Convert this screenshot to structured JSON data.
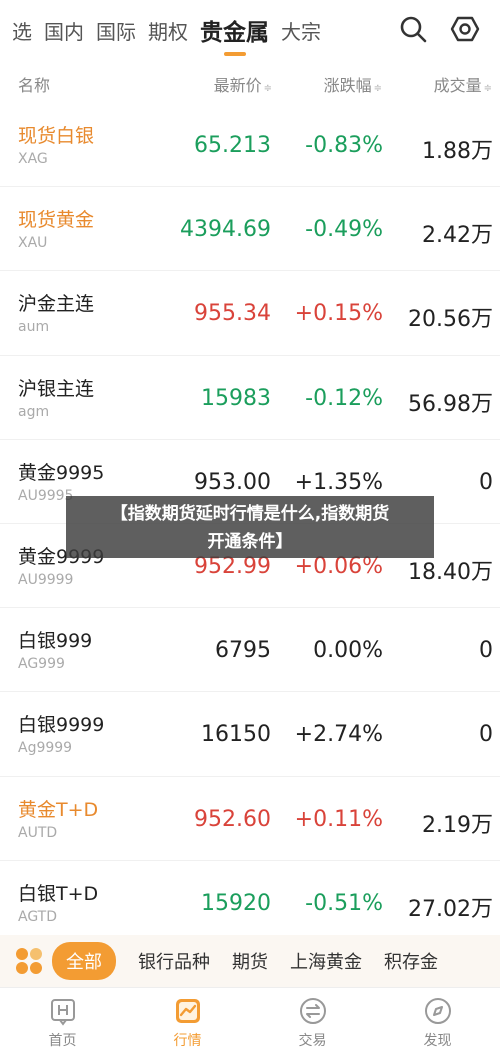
{
  "top_tabs": [
    {
      "label": "选"
    },
    {
      "label": "国内"
    },
    {
      "label": "国际"
    },
    {
      "label": "期权"
    },
    {
      "label": "贵金属",
      "active": true
    },
    {
      "label": "大宗"
    }
  ],
  "header": {
    "name": "名称",
    "price": "最新价",
    "change": "涨跌幅",
    "volume": "成交量",
    "sort_glyph": "≑"
  },
  "rows": [
    {
      "name": "现货白银",
      "code": "XAG",
      "price": "65.213",
      "change": "-0.83%",
      "volume": "1.88万",
      "name_color": "orange",
      "price_color": "green",
      "change_color": "green"
    },
    {
      "name": "现货黄金",
      "code": "XAU",
      "price": "4394.69",
      "change": "-0.49%",
      "volume": "2.42万",
      "name_color": "orange",
      "price_color": "green",
      "change_color": "green"
    },
    {
      "name": "沪金主连",
      "code": "aum",
      "price": "955.34",
      "change": "+0.15%",
      "volume": "20.56万",
      "name_color": "black",
      "price_color": "red",
      "change_color": "red"
    },
    {
      "name": "沪银主连",
      "code": "agm",
      "price": "15983",
      "change": "-0.12%",
      "volume": "56.98万",
      "name_color": "black",
      "price_color": "green",
      "change_color": "green"
    },
    {
      "name": "黄金9995",
      "code": "AU9995",
      "price": "953.00",
      "change": "+1.35%",
      "volume": "0",
      "name_color": "black",
      "price_color": "black",
      "change_color": "black"
    },
    {
      "name": "黄金9999",
      "code": "AU9999",
      "price": "952.99",
      "change": "+0.06%",
      "volume": "18.40万",
      "name_color": "black",
      "price_color": "red",
      "change_color": "red"
    },
    {
      "name": "白银999",
      "code": "AG999",
      "price": "6795",
      "change": "0.00%",
      "volume": "0",
      "name_color": "black",
      "price_color": "black",
      "change_color": "black"
    },
    {
      "name": "白银9999",
      "code": "Ag9999",
      "price": "16150",
      "change": "+2.74%",
      "volume": "0",
      "name_color": "black",
      "price_color": "black",
      "change_color": "black"
    },
    {
      "name": "黄金T+D",
      "code": "AUTD",
      "price": "952.60",
      "change": "+0.11%",
      "volume": "2.19万",
      "name_color": "orange",
      "price_color": "red",
      "change_color": "red"
    },
    {
      "name": "白银T+D",
      "code": "AGTD",
      "price": "15920",
      "change": "-0.51%",
      "volume": "27.02万",
      "name_color": "black",
      "price_color": "green",
      "change_color": "green"
    }
  ],
  "banner": {
    "line1": "【指数期货延时行情是什么,指数期货",
    "line2": "开通条件】"
  },
  "categories": {
    "all": "全部",
    "items": [
      "银行品种",
      "期货",
      "上海黄金",
      "积存金"
    ]
  },
  "bottom_nav": [
    {
      "label": "首页",
      "icon": "home-icon"
    },
    {
      "label": "行情",
      "icon": "chart-icon",
      "active": true
    },
    {
      "label": "交易",
      "icon": "exchange-icon"
    },
    {
      "label": "发现",
      "icon": "compass-icon"
    }
  ],
  "colors": {
    "accent": "#f39c33",
    "up": "#d9433a",
    "down": "#1b9e5c"
  }
}
